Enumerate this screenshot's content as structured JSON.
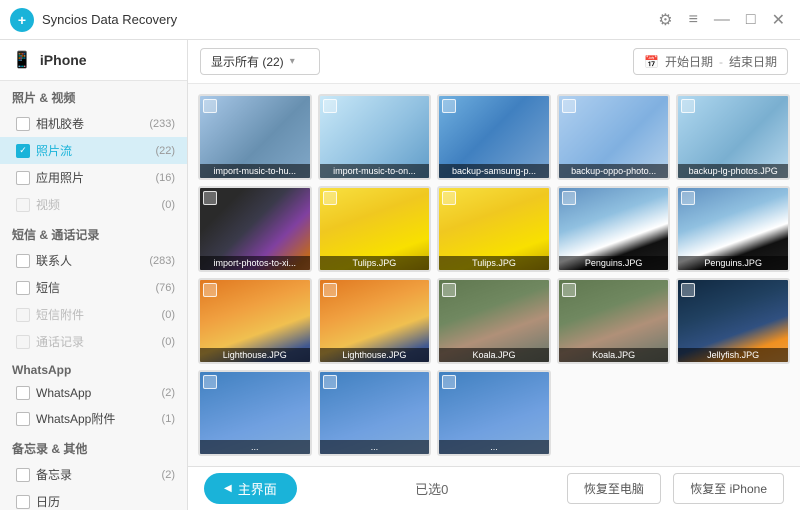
{
  "titlebar": {
    "title": "Syncios Data Recovery",
    "logo": "+",
    "icons": {
      "settings": "⚙",
      "menu": "≡",
      "minimize": "—",
      "maximize": "□",
      "close": "✕"
    }
  },
  "sidebar": {
    "device": "iPhone",
    "sections": [
      {
        "title": "照片 & 视频",
        "items": [
          {
            "id": "camera-roll",
            "label": "相机胶卷",
            "count": "(233)",
            "checked": false,
            "disabled": false,
            "active": false
          },
          {
            "id": "photo-stream",
            "label": "照片流",
            "count": "(22)",
            "checked": true,
            "disabled": false,
            "active": true
          },
          {
            "id": "app-photos",
            "label": "应用照片",
            "count": "(16)",
            "checked": false,
            "disabled": false,
            "active": false
          },
          {
            "id": "videos",
            "label": "视频",
            "count": "(0)",
            "checked": false,
            "disabled": true,
            "active": false
          }
        ]
      },
      {
        "title": "短信 & 通话记录",
        "items": [
          {
            "id": "contacts",
            "label": "联系人",
            "count": "(283)",
            "checked": false,
            "disabled": false,
            "active": false
          },
          {
            "id": "sms",
            "label": "短信",
            "count": "(76)",
            "checked": false,
            "disabled": false,
            "active": false
          },
          {
            "id": "sms-attachments",
            "label": "短信附件",
            "count": "(0)",
            "checked": false,
            "disabled": true,
            "active": false
          },
          {
            "id": "call-logs",
            "label": "通话记录",
            "count": "(0)",
            "checked": false,
            "disabled": true,
            "active": false
          }
        ]
      },
      {
        "title": "WhatsApp",
        "items": [
          {
            "id": "whatsapp",
            "label": "WhatsApp",
            "count": "(2)",
            "checked": false,
            "disabled": false,
            "active": false
          },
          {
            "id": "whatsapp-attachments",
            "label": "WhatsApp附件",
            "count": "(1)",
            "checked": false,
            "disabled": false,
            "active": false
          }
        ]
      },
      {
        "title": "备忘录 & 其他",
        "items": [
          {
            "id": "notes",
            "label": "备忘录",
            "count": "(2)",
            "checked": false,
            "disabled": false,
            "active": false
          },
          {
            "id": "other",
            "label": "日历",
            "count": "(??)",
            "checked": false,
            "disabled": false,
            "active": false
          }
        ]
      }
    ]
  },
  "toolbar": {
    "filter_label": "显示所有 (22)",
    "filter_arrow": "▾",
    "date_icon": "📅",
    "start_date": "开始日期",
    "end_date": "结束日期",
    "date_sep": "-"
  },
  "photos": [
    {
      "id": "p1",
      "label": "import-music-to-hu...",
      "thumb_class": "thumb-screenshot1"
    },
    {
      "id": "p2",
      "label": "import-music-to-on...",
      "thumb_class": "thumb-screenshot2"
    },
    {
      "id": "p3",
      "label": "backup-samsung-p...",
      "thumb_class": "thumb-screenshot3"
    },
    {
      "id": "p4",
      "label": "backup-oppo-photo...",
      "thumb_class": "thumb-screenshot4"
    },
    {
      "id": "p5",
      "label": "backup-lg-photos.JPG",
      "thumb_class": "thumb-screenshot5"
    },
    {
      "id": "p6",
      "label": "import-photos-to-xi...",
      "thumb_class": "thumb-photos1"
    },
    {
      "id": "p7",
      "label": "Tulips.JPG",
      "thumb_class": "thumb-tulips1"
    },
    {
      "id": "p8",
      "label": "Tulips.JPG",
      "thumb_class": "thumb-tulips2"
    },
    {
      "id": "p9",
      "label": "Penguins.JPG",
      "thumb_class": "thumb-penguins1"
    },
    {
      "id": "p10",
      "label": "Penguins.JPG",
      "thumb_class": "thumb-penguins2"
    },
    {
      "id": "p11",
      "label": "Lighthouse.JPG",
      "thumb_class": "thumb-lighthouse"
    },
    {
      "id": "p12",
      "label": "Lighthouse.JPG",
      "thumb_class": "thumb-lighthouse2"
    },
    {
      "id": "p13",
      "label": "Koala.JPG",
      "thumb_class": "thumb-koala"
    },
    {
      "id": "p14",
      "label": "Koala.JPG",
      "thumb_class": "thumb-koala2"
    },
    {
      "id": "p15",
      "label": "Jellyfish.JPG",
      "thumb_class": "thumb-jellyfish"
    },
    {
      "id": "p16",
      "label": "...",
      "thumb_class": "thumb-partial"
    },
    {
      "id": "p17",
      "label": "...",
      "thumb_class": "thumb-partial"
    },
    {
      "id": "p18",
      "label": "...",
      "thumb_class": "thumb-partial"
    }
  ],
  "statusbar": {
    "home_button_icon": "◀",
    "home_button_label": "主界面",
    "selected_label": "已选0",
    "restore_pc_label": "恢复至电脑",
    "restore_iphone_label": "恢复至 iPhone"
  }
}
